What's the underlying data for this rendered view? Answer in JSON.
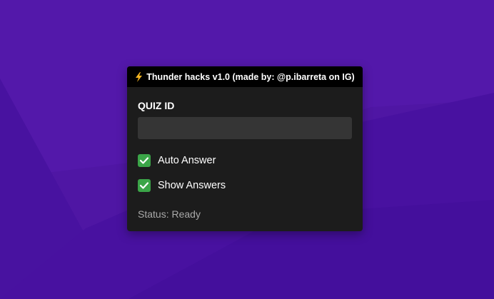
{
  "window": {
    "title": "Thunder hacks v1.0 (made by: @p.ibarreta on IG)",
    "title_icon": "lightning-bolt-icon"
  },
  "form": {
    "quiz_id_label": "QUIZ ID",
    "quiz_id_value": "",
    "quiz_id_placeholder": ""
  },
  "options": [
    {
      "label": "Auto Answer",
      "checked": true
    },
    {
      "label": "Show Answers",
      "checked": true
    }
  ],
  "status": {
    "text": "Status: Ready"
  },
  "colors": {
    "background": "#4e15a3",
    "panel": "#1c1c1c",
    "titlebar": "#000000",
    "input": "#353535",
    "checkbox": "#3ba548",
    "bolt": "#f5b521",
    "status_text": "#a9a9a9"
  }
}
